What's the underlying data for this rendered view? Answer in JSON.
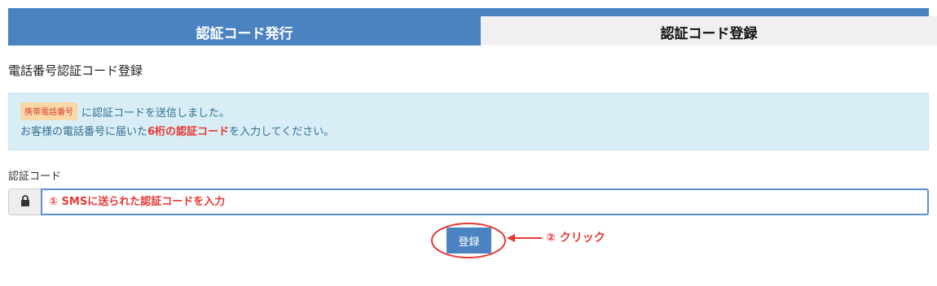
{
  "tabs": [
    {
      "label": "認証コード発行"
    },
    {
      "label": "認証コード登録"
    }
  ],
  "section_title": "電話番号認証コード登録",
  "info": {
    "phone_badge": "携帯電話番号",
    "line1_text": "に認証コードを送信しました。",
    "line2_before": "お客様の電話番号に届いた",
    "line2_highlight": "6桁の認証コード",
    "line2_after": "を入力してください。"
  },
  "form": {
    "code_label": "認証コード",
    "code_placeholder": "① SMSに送られた認証コードを入力"
  },
  "register_button": "登録",
  "annotation_click": "② クリック",
  "icons": {
    "addon": "lock-icon"
  },
  "colors": {
    "primary": "#4a82c2",
    "accent_red": "#e53935",
    "info_bg": "#d9edf7"
  }
}
